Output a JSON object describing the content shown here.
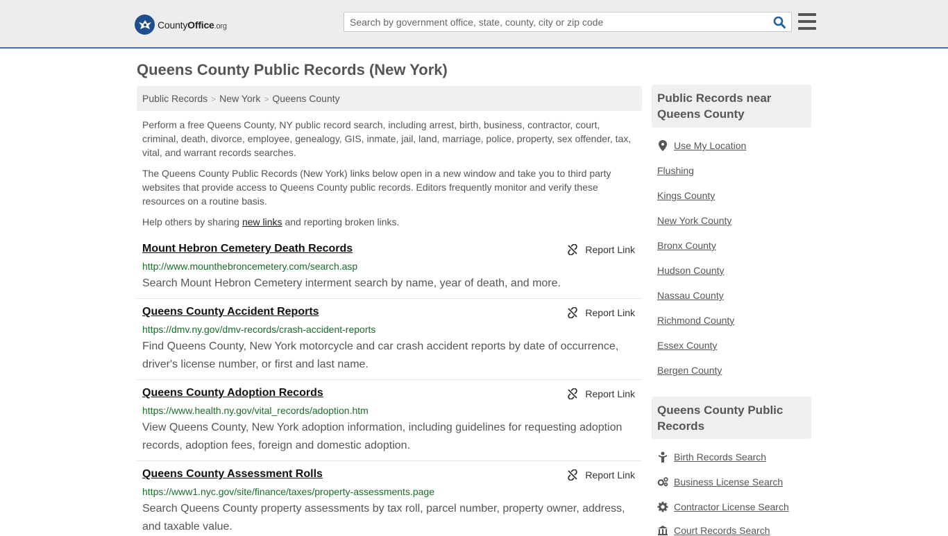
{
  "header": {
    "logo_name": "County",
    "logo_bold": "Office",
    "logo_tld": ".org",
    "search_placeholder": "Search by government office, state, county, city or zip code"
  },
  "page": {
    "title": "Queens County Public Records (New York)"
  },
  "breadcrumb": [
    "Public Records",
    "New York",
    "Queens County"
  ],
  "intro": {
    "para1": "Perform a free Queens County, NY public record search, including arrest, birth, business, contractor, court, criminal, death, divorce, employee, genealogy, GIS, inmate, jail, land, marriage, police, property, sex offender, tax, vital, and warrant records searches.",
    "para2": "The Queens County Public Records (New York) links below open in a new window and take you to third party websites that provide access to Queens County public records. Editors frequently monitor and verify these resources on a routine basis.",
    "help_before": "Help others by sharing ",
    "help_link": "new links",
    "help_after": " and reporting broken links."
  },
  "report_label": "Report Link",
  "records": [
    {
      "title": "Mount Hebron Cemetery Death Records",
      "url": "http://www.mounthebroncemetery.com/search.asp",
      "desc": "Search Mount Hebron Cemetery interment search by name, year of death, and more."
    },
    {
      "title": "Queens County Accident Reports",
      "url": "https://dmv.ny.gov/dmv-records/crash-accident-reports",
      "desc": "Find Queens County, New York motorcycle and car crash accident reports by date of occurrence, driver's license number, or first and last name."
    },
    {
      "title": "Queens County Adoption Records",
      "url": "https://www.health.ny.gov/vital_records/adoption.htm",
      "desc": "View Queens County, New York adoption information, including guidelines for requesting adoption records, adoption fees, foreign and domestic adoption."
    },
    {
      "title": "Queens County Assessment Rolls",
      "url": "https://www1.nyc.gov/site/finance/taxes/property-assessments.page",
      "desc": "Search Queens County property assessments by tax roll, parcel number, property owner, address, and taxable value."
    }
  ],
  "sidebar": {
    "near_heading": "Public Records near Queens County",
    "use_location": "Use My Location",
    "near_links": [
      "Flushing",
      "Kings County",
      "New York County",
      "Bronx County",
      "Hudson County",
      "Nassau County",
      "Richmond County",
      "Essex County",
      "Bergen County"
    ],
    "records_heading": "Queens County Public Records",
    "record_links": [
      "Birth Records Search",
      "Business License Search",
      "Contractor License Search",
      "Court Records Search"
    ]
  },
  "colors": {
    "accent": "#3f72b5",
    "url_green": "#1b6b2a",
    "logo_blue": "#1f4e8c"
  }
}
